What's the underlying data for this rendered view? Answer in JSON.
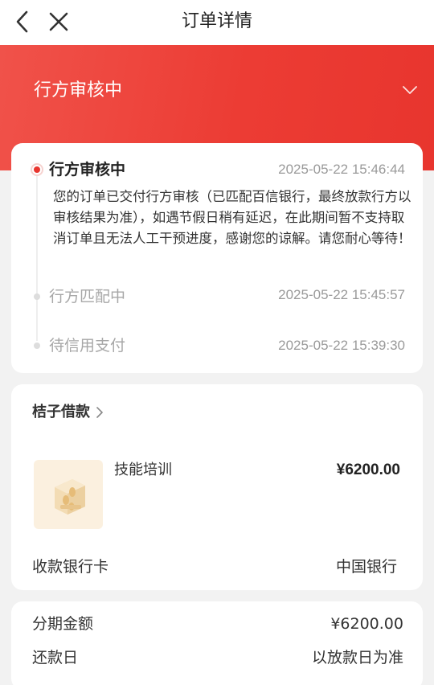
{
  "nav": {
    "title": "订单详情",
    "back_icon": "back-arrow-icon",
    "close_icon": "close-icon"
  },
  "status": {
    "title": "行方审核中",
    "expand_icon": "chevron-down-icon",
    "colors": {
      "header": "#e8352e",
      "accent": "#e8352e"
    }
  },
  "timeline": {
    "items": [
      {
        "label": "行方审核中",
        "time": "2025-05-22 15:46:44",
        "description": "您的订单已交付行方审核（已匹配百信银行，最终放款行方以审核结果为准），如遇节假日稍有延迟，在此期间暂不支持取消订单且无法人工干预进度，感谢您的谅解。请您耐心等待！"
      },
      {
        "label": "行方匹配中",
        "time": "2025-05-22 15:45:57"
      },
      {
        "label": "待信用支付",
        "time": "2025-05-22 15:39:30"
      }
    ]
  },
  "order": {
    "merchant": "桔子借款",
    "product_name": "技能培训",
    "price": "¥6200.00",
    "bank_card_label": "收款银行卡",
    "bank_card_value": "中国银行"
  },
  "installment": {
    "amount_label": "分期金额",
    "amount_value": "¥6200.00",
    "repay_label": "还款日",
    "repay_value": "以放款日为准"
  }
}
